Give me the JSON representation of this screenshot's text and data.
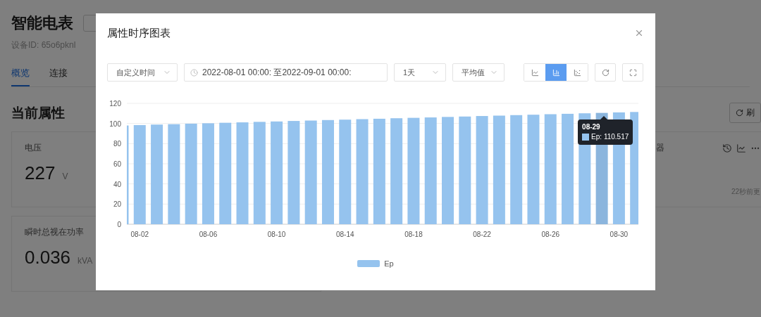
{
  "page": {
    "title": "智能电表",
    "device_id": "设备ID: 65o6pknl",
    "tabs": [
      {
        "label": "概览",
        "selected": true
      },
      {
        "label": "连接",
        "selected": false
      }
    ],
    "section_title": "当前属性",
    "refresh_button": "刷",
    "cards": [
      {
        "label": "电压",
        "value": "227",
        "unit": "V"
      },
      {
        "label": "瞬时总视在功率",
        "value": "0.036",
        "unit": "kVA"
      }
    ],
    "side_card": {
      "label": "器",
      "updated": "22秒前更"
    }
  },
  "modal": {
    "title": "属性时序图表",
    "toolbar": {
      "range_select": "自定义时间",
      "date_range": "2022-08-01 00:00: 至2022-09-01 00:00:",
      "interval_select": "1天",
      "aggregate_select": "平均值",
      "chart_types": [
        {
          "kind": "line",
          "selected": false
        },
        {
          "kind": "bar",
          "selected": true
        },
        {
          "kind": "scatter",
          "selected": false
        }
      ]
    },
    "chart_data": {
      "type": "bar",
      "grid": true,
      "categories": [
        null,
        "08-02",
        null,
        null,
        null,
        "08-06",
        null,
        null,
        null,
        "08-10",
        null,
        null,
        null,
        "08-14",
        null,
        null,
        null,
        "08-18",
        null,
        null,
        null,
        "08-22",
        null,
        null,
        null,
        "08-26",
        null,
        null,
        null,
        "08-30",
        null
      ],
      "series": [
        {
          "name": "Ep",
          "color": "#95c3ee",
          "values": [
            98.0,
            98.4,
            98.9,
            99.3,
            99.8,
            100.2,
            100.7,
            101.1,
            101.6,
            102.0,
            102.5,
            102.9,
            103.4,
            103.8,
            104.3,
            104.7,
            105.2,
            105.6,
            106.0,
            106.5,
            106.9,
            107.4,
            107.8,
            108.3,
            108.7,
            109.2,
            109.6,
            110.1,
            110.5,
            111.0,
            111.4
          ]
        }
      ],
      "ylim": [
        0,
        120
      ],
      "yticks": [
        0,
        20,
        40,
        60,
        80,
        100,
        120
      ]
    },
    "tooltip": {
      "date": "08-29",
      "text": "Ep: 110.517"
    }
  }
}
